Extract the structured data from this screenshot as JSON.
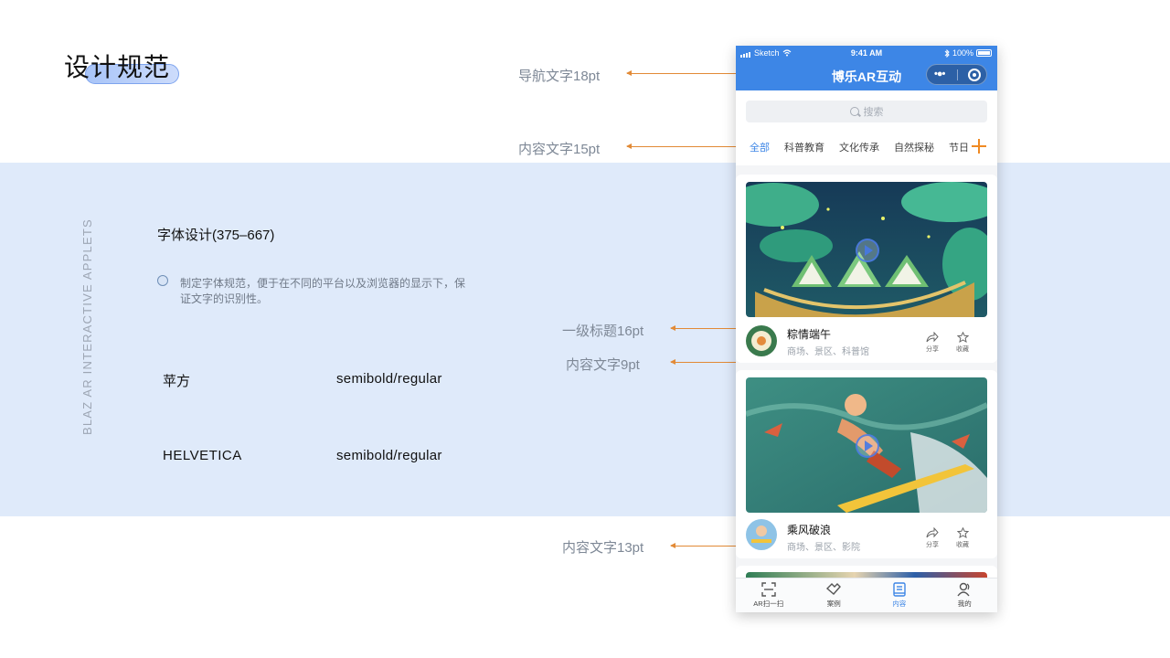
{
  "board": {
    "title": "设计规范",
    "vertical_label": "BLAZ AR INTERACTIVE APPLETS",
    "section_heading": "字体设计(375–667)",
    "bullet_text": "制定字体规范，便于在不同的平台以及浏览器的显示下，保证文字的识别性。",
    "fonts": [
      {
        "name": "苹方",
        "weight": "semibold/regular"
      },
      {
        "name": "HELVETICA",
        "weight": "semibold/regular"
      }
    ]
  },
  "annotations": [
    {
      "label": "导航文字18pt"
    },
    {
      "label": "内容文字15pt"
    },
    {
      "label": "一级标题16pt"
    },
    {
      "label": "内容文字9pt"
    },
    {
      "label": "内容文字13pt"
    }
  ],
  "phone": {
    "status": {
      "carrier": "Sketch",
      "time": "9:41 AM",
      "battery": "100%"
    },
    "nav_title": "博乐AR互动",
    "capsule_dots": "•●•",
    "search_placeholder": "搜索",
    "tabs": [
      "全部",
      "科普教育",
      "文化传承",
      "自然探秘",
      "节日"
    ],
    "cards": [
      {
        "title": "粽情端午",
        "subtitle": "商场、景区、科普馆",
        "share": "分享",
        "favorite": "收藏"
      },
      {
        "title": "乘风破浪",
        "subtitle": "商场、景区、影院",
        "share": "分享",
        "favorite": "收藏"
      }
    ],
    "tabbar": [
      "AR扫一扫",
      "案例",
      "内容",
      "我的"
    ],
    "active_tab_index": 2
  },
  "colors": {
    "accent": "#3d86e6",
    "annotation": "#e28a36",
    "band": "#dfeafa"
  }
}
